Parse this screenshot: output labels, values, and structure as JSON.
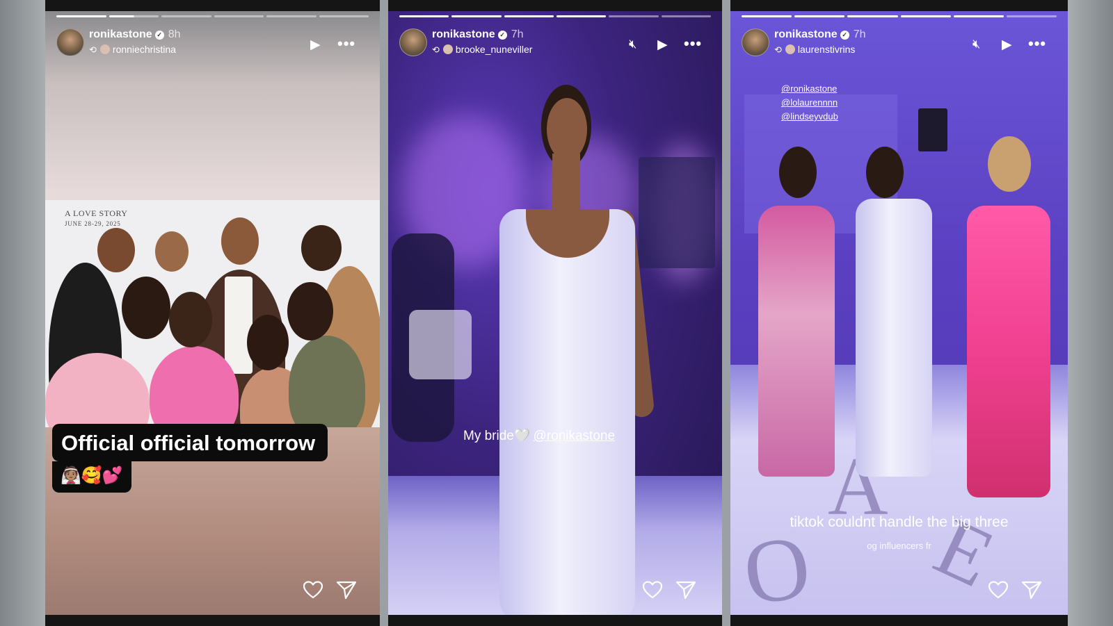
{
  "stories": [
    {
      "username": "ronikastone",
      "time": "8h",
      "reposted_from": "ronniechristina",
      "progress": {
        "segments": 6,
        "complete": 1,
        "current_fraction": 0.5
      },
      "photo_banner": {
        "line1": "A LOVE STORY",
        "line2": "JUNE 28-29, 2025"
      },
      "caption": "Official official tomorrow",
      "caption_emoji": "👰🏽🥰💕",
      "controls": [
        "play-icon",
        "more-icon"
      ],
      "actions": [
        "heart-icon",
        "send-icon"
      ]
    },
    {
      "username": "ronikastone",
      "time": "7h",
      "reposted_from": "brooke_nuneviller",
      "progress": {
        "segments": 6,
        "complete": 4,
        "current_fraction": 0
      },
      "caption": "My bride🤍",
      "caption_tag": "@ronikastone",
      "controls": [
        "mute-icon",
        "play-icon",
        "more-icon"
      ],
      "actions": [
        "heart-icon",
        "send-icon"
      ]
    },
    {
      "username": "ronikastone",
      "time": "7h",
      "reposted_from": "laurenstivrins",
      "progress": {
        "segments": 6,
        "complete": 5,
        "current_fraction": 0
      },
      "mentions": [
        "@ronikastone",
        "@lolaurennnn",
        "@lindseyvdub"
      ],
      "caption": "tiktok couldnt handle the big three",
      "subcaption": "og influencers fr",
      "controls": [
        "mute-icon",
        "play-icon",
        "more-icon"
      ],
      "actions": [
        "heart-icon",
        "send-icon"
      ]
    }
  ],
  "colors": {
    "accent": "#ffffff",
    "caption_bg": "#0c0c0c",
    "violet_light": "#5b41c2"
  }
}
